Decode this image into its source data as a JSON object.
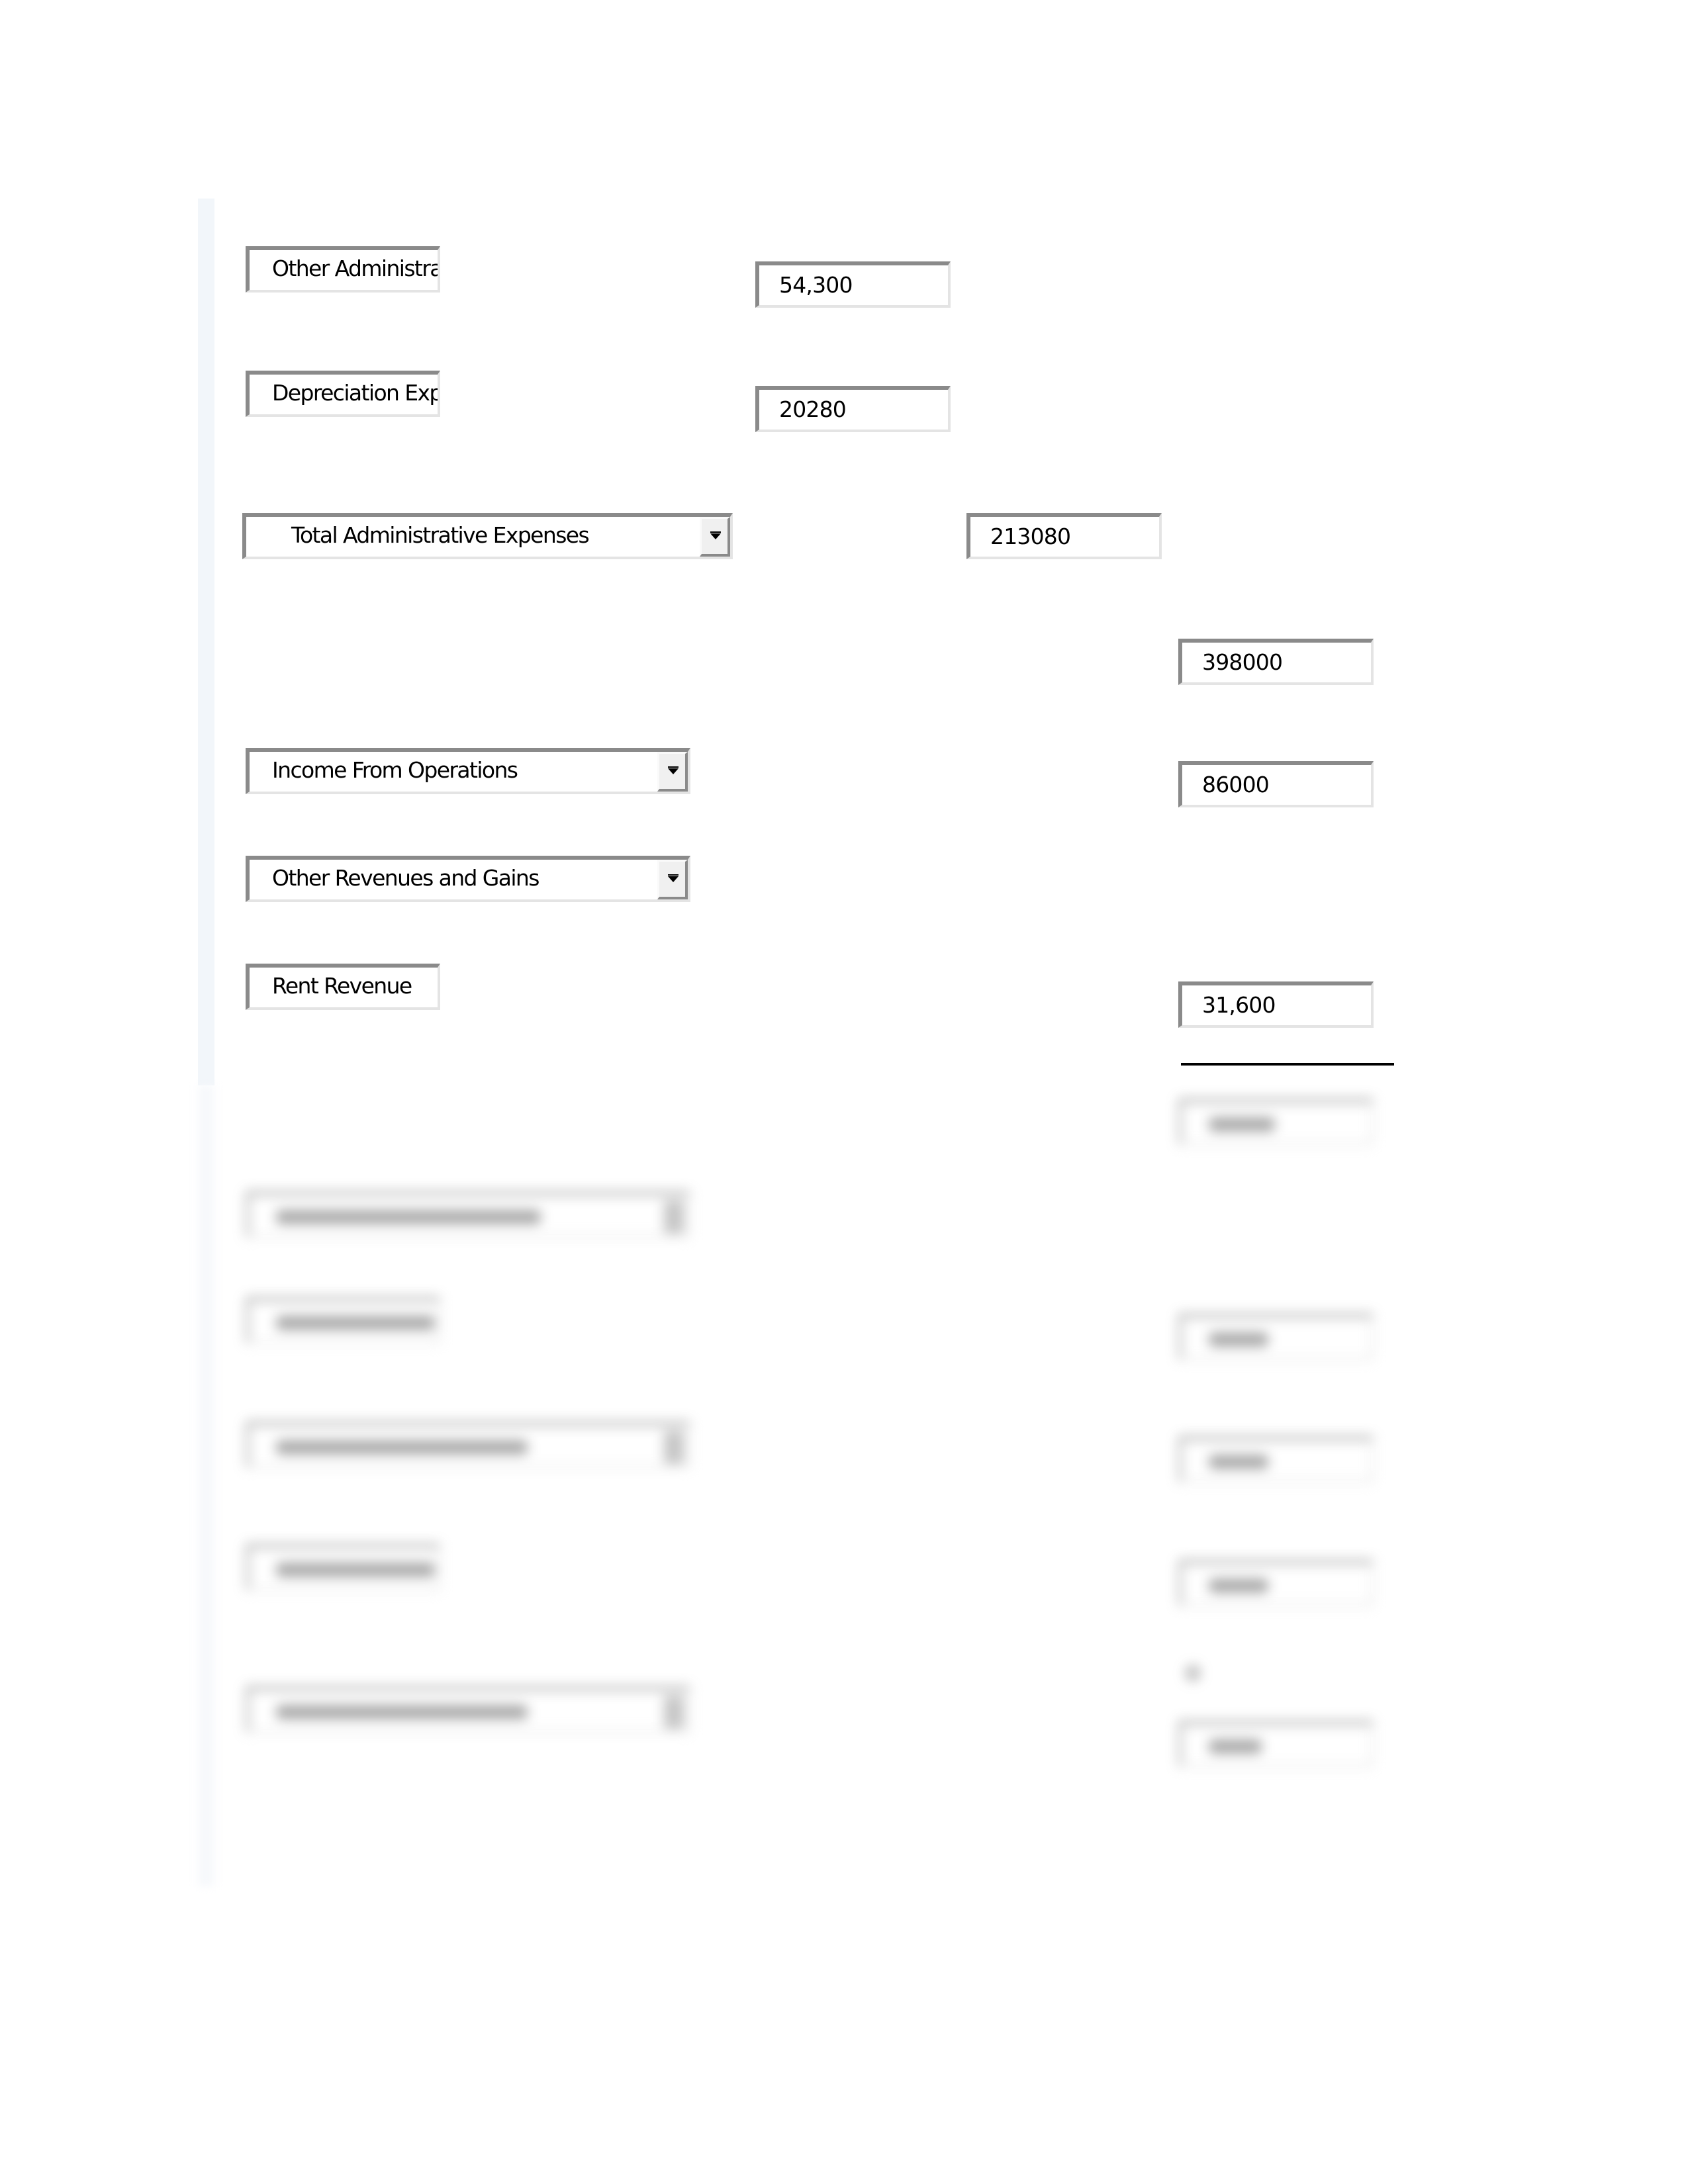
{
  "statement": {
    "rows": [
      {
        "label": "Other Administrati",
        "label_kind": "text",
        "value": "54,300",
        "value_column": 1
      },
      {
        "label": "Depreciation Expe",
        "label_kind": "text",
        "value": "20280",
        "value_column": 1
      },
      {
        "label": "Total Administrative Expenses",
        "label_kind": "dropdown",
        "value": "213080",
        "value_column": 2
      },
      {
        "label": "",
        "label_kind": "none",
        "value": "398000",
        "value_column": 3
      },
      {
        "label": "Income From Operations",
        "label_kind": "dropdown",
        "value": "86000",
        "value_column": 3
      },
      {
        "label": "Other Revenues and Gains",
        "label_kind": "dropdown",
        "value": "",
        "value_column": 3
      },
      {
        "label": "Rent Revenue",
        "label_kind": "text",
        "value": "31,600",
        "value_column": 3
      }
    ],
    "dropdown_icon": "chevron-down-icon",
    "blurred_section_note": "Remaining rows are obscured (blurred) and illegible"
  }
}
